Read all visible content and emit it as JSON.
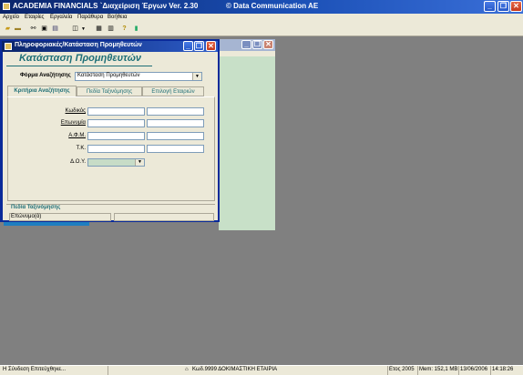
{
  "app": {
    "title": "ACADEMIA FINANCIALS `Διαχείριση Έργων Ver. 2.30",
    "company": "© Data Communication AE"
  },
  "menu": [
    "Αρχείο",
    "Εταιρίες",
    "Εργαλεία",
    "Παράθυρα",
    "Βοήθεια"
  ],
  "dialog": {
    "title": "Πληροφοριακές/Κατάσταση Προμηθευτών",
    "heading": "Κατάσταση Προμηθευτών",
    "form_label": "Φόρμα Αναζήτησης",
    "form_value": "Κατάσταση Προμηθευτών",
    "tabs": [
      "Κριτήρια Αναζήτησης",
      "Πεδία Ταξινόμησης",
      "Επιλογή Εταιριών"
    ],
    "fields": [
      "Κωδικός",
      "Επωνυμία",
      "Α.Φ.Μ.",
      "Τ.Κ.",
      "Δ.Ο.Υ."
    ],
    "sort_section": "Πεδία Ταξινόμησης",
    "sort_value": "Επώνυμο(ά)"
  },
  "statusbar": {
    "connection": "Η Σύνδεση Επιτεύχθηκε...",
    "company": "Κωδ.9999 ΔΟΚΙΜΑΣΤΙΚΗ ΕΤΑΙΡΙΑ",
    "year": "Ετος 2005",
    "memory": "Mem: 152,1 MB",
    "date": "13/06/2006",
    "time": "14:18:26"
  }
}
